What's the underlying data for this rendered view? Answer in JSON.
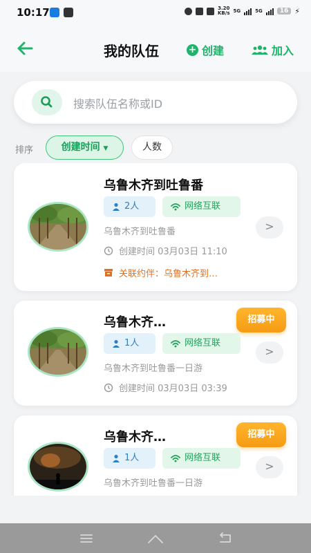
{
  "status_bar": {
    "time": "10:17",
    "net_speed_value": "3.20",
    "net_speed_unit": "KB/s",
    "network_1": "5G",
    "network_2": "5G",
    "battery": "16"
  },
  "header": {
    "title": "我的队伍",
    "create_label": "创建",
    "join_label": "加入",
    "accent_color": "#1fb36b"
  },
  "search": {
    "placeholder": "搜索队伍名称或ID"
  },
  "sort": {
    "label": "排序",
    "options": [
      {
        "label": "创建时间",
        "active": true
      },
      {
        "label": "人数",
        "active": false
      }
    ]
  },
  "teams": [
    {
      "name": "乌鲁木齐到吐鲁番",
      "members": "2人",
      "network": "网络互联",
      "description": "乌鲁木齐到吐鲁番",
      "created": "创建时间 03月03日 11:10",
      "linked": "关联约伴：乌鲁木齐到…",
      "badge": "",
      "avatar": "vineyard-photo"
    },
    {
      "name": "乌鲁木齐…",
      "members": "1人",
      "network": "网络互联",
      "description": "乌鲁木齐到吐鲁番一日游",
      "created": "创建时间 03月03日 03:39",
      "linked": "",
      "badge": "招募中",
      "avatar": "vineyard-photo"
    },
    {
      "name": "乌鲁木齐…",
      "members": "1人",
      "network": "网络互联",
      "description": "乌鲁木齐到吐鲁番一日游",
      "created": "",
      "linked": "",
      "badge": "招募中",
      "avatar": "night-silhouette-photo"
    }
  ],
  "colors": {
    "green": "#1fb36b",
    "blue_tag": "#2f7fc0",
    "orange": "#e07020",
    "badge": "#f5a21a"
  }
}
